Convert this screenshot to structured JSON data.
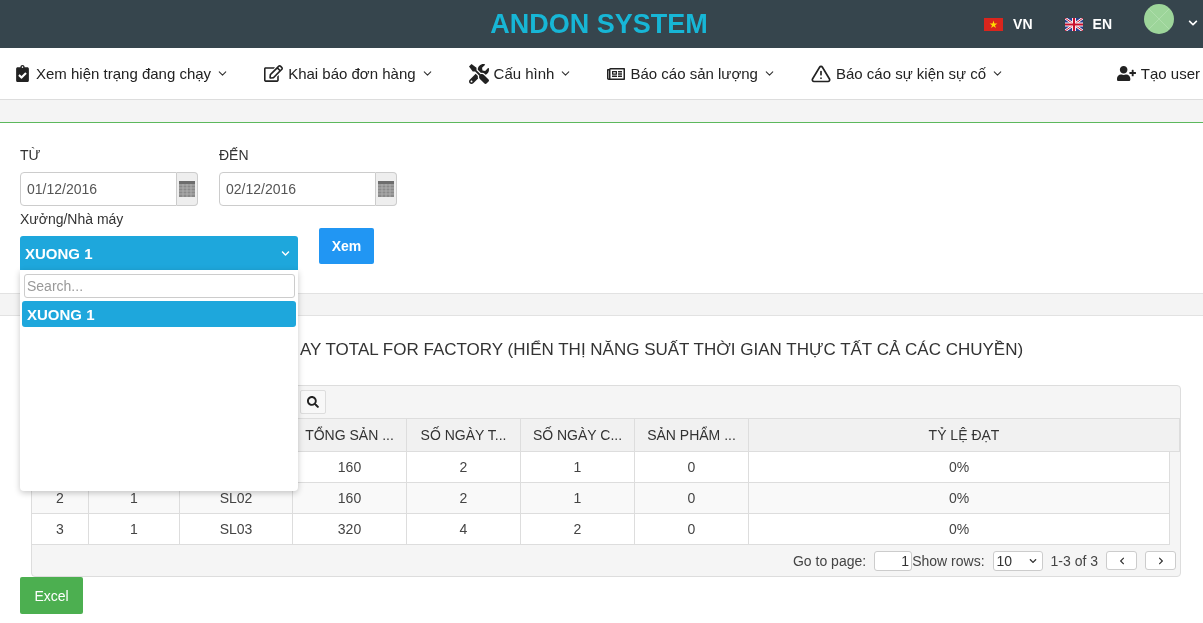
{
  "header": {
    "title": "ANDON SYSTEM",
    "languages": [
      {
        "kind": "vn",
        "label": "VN"
      },
      {
        "kind": "gb",
        "label": "EN"
      }
    ]
  },
  "nav": {
    "items": [
      {
        "kind": "status",
        "label": "Xem hiện trạng đang chạy"
      },
      {
        "kind": "orders",
        "label": "Khai báo đơn hàng"
      },
      {
        "kind": "config",
        "label": "Cấu hình"
      },
      {
        "kind": "production",
        "label": "Báo cáo sản lượng"
      },
      {
        "kind": "incidents",
        "label": "Báo cáo sự kiện sự cố"
      }
    ],
    "create_user": {
      "label": "Tạo user"
    }
  },
  "filters": {
    "from": {
      "label": "TỪ",
      "value": "01/12/2016"
    },
    "to": {
      "label": "ĐẾN",
      "value": "02/12/2016"
    },
    "factory": {
      "label": "Xưởng/Nhà máy",
      "value": "XUONG 1",
      "expanded": true,
      "search": {
        "placeholder": "Search..."
      },
      "options": [
        {
          "label": "XUONG 1",
          "selected": true
        }
      ]
    },
    "view_button": "Xem"
  },
  "report": {
    "title": "AY TOTAL FOR FACTORY (HIỂN THỊ NĂNG SUẤT THỜI GIAN THỰC TẤT CẢ CÁC CHUYỀN)",
    "table": {
      "columns": [
        "TỔNG SẢN ...",
        "SỐ NGÀY T...",
        "SỐ NGÀY C...",
        "SẢN PHẨM ...",
        "TỶ LỆ ĐẠT"
      ],
      "rows": [
        [
          "160",
          "2",
          "1",
          "0",
          "0%"
        ],
        [
          "2",
          "1",
          "SL02",
          "160",
          "2",
          "1",
          "0",
          "0%"
        ],
        [
          "3",
          "1",
          "SL03",
          "320",
          "4",
          "2",
          "0",
          "0%"
        ]
      ],
      "pager": {
        "go_to_label": "Go to page:",
        "page": "1",
        "show_rows_label": "Show rows:",
        "rows_per_page": "10",
        "range": "1-3 of 3"
      }
    }
  },
  "excel_button": "Excel"
}
